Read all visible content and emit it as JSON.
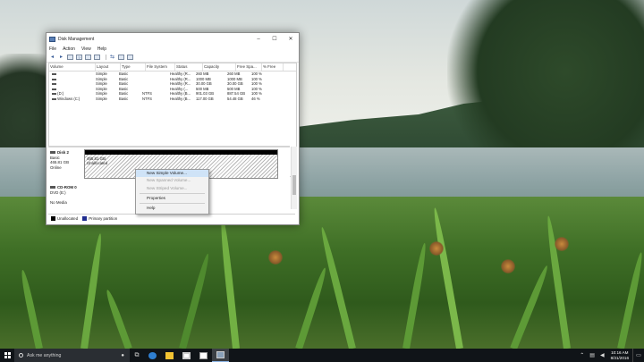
{
  "window": {
    "title": "Disk Management",
    "controls": {
      "minimize": "–",
      "maximize": "☐",
      "close": "✕"
    },
    "menu": [
      "File",
      "Action",
      "View",
      "Help"
    ]
  },
  "volumes": {
    "columns": [
      "Volume",
      "Layout",
      "Type",
      "File System",
      "Status",
      "Capacity",
      "Free Spa...",
      "% Free"
    ],
    "rows": [
      {
        "volume": "",
        "layout": "Simple",
        "type": "Basic",
        "fs": "",
        "status": "Healthy (R...",
        "capacity": "260 MB",
        "free": "260 MB",
        "pct": "100 %"
      },
      {
        "volume": "",
        "layout": "Simple",
        "type": "Basic",
        "fs": "",
        "status": "Healthy (R...",
        "capacity": "1000 MB",
        "free": "1000 MB",
        "pct": "100 %"
      },
      {
        "volume": "",
        "layout": "Simple",
        "type": "Basic",
        "fs": "",
        "status": "Healthy (R...",
        "capacity": "30.00 GB",
        "free": "30.00 GB",
        "pct": "100 %"
      },
      {
        "volume": "",
        "layout": "Simple",
        "type": "Basic",
        "fs": "",
        "status": "Healthy (...",
        "capacity": "500 MB",
        "free": "500 MB",
        "pct": "100 %"
      },
      {
        "volume": "(D:)",
        "layout": "Simple",
        "type": "Basic",
        "fs": "NTFS",
        "status": "Healthy (B...",
        "capacity": "901.03 GB",
        "free": "887.54 GB",
        "pct": "100 %"
      },
      {
        "volume": "Windows (C:)",
        "layout": "Simple",
        "type": "Basic",
        "fs": "NTFS",
        "status": "Healthy (B...",
        "capacity": "117.00 GB",
        "free": "54.48 GB",
        "pct": "46 %"
      }
    ]
  },
  "disks": [
    {
      "name": "Disk 2",
      "type": "Basic",
      "size": "465.81 GB",
      "state": "Online",
      "partition_size": "465.81 GB",
      "partition_state": "Unallocated"
    },
    {
      "name": "CD-ROM 0",
      "type": "DVD (E:)",
      "media": "No Media"
    }
  ],
  "legend": [
    "Unallocated",
    "Primary partition"
  ],
  "colors": {
    "unallocated": "#000000",
    "primary": "#1f2c8f",
    "accent": "#cfe3f7"
  },
  "context_menu": [
    {
      "label": "New Simple Volume...",
      "state": "highlighted"
    },
    {
      "label": "New Spanned Volume...",
      "state": "disabled"
    },
    {
      "label": "New Striped Volume...",
      "state": "disabled"
    },
    {
      "label": "Properties",
      "state": "normal"
    },
    {
      "label": "Help",
      "state": "normal"
    }
  ],
  "taskbar": {
    "search_placeholder": "Ask me anything",
    "apps": [
      "task-view",
      "edge",
      "file-explorer",
      "store",
      "photos",
      "disk-management"
    ],
    "time": "10:16 AM",
    "date": "8/31/2016"
  }
}
